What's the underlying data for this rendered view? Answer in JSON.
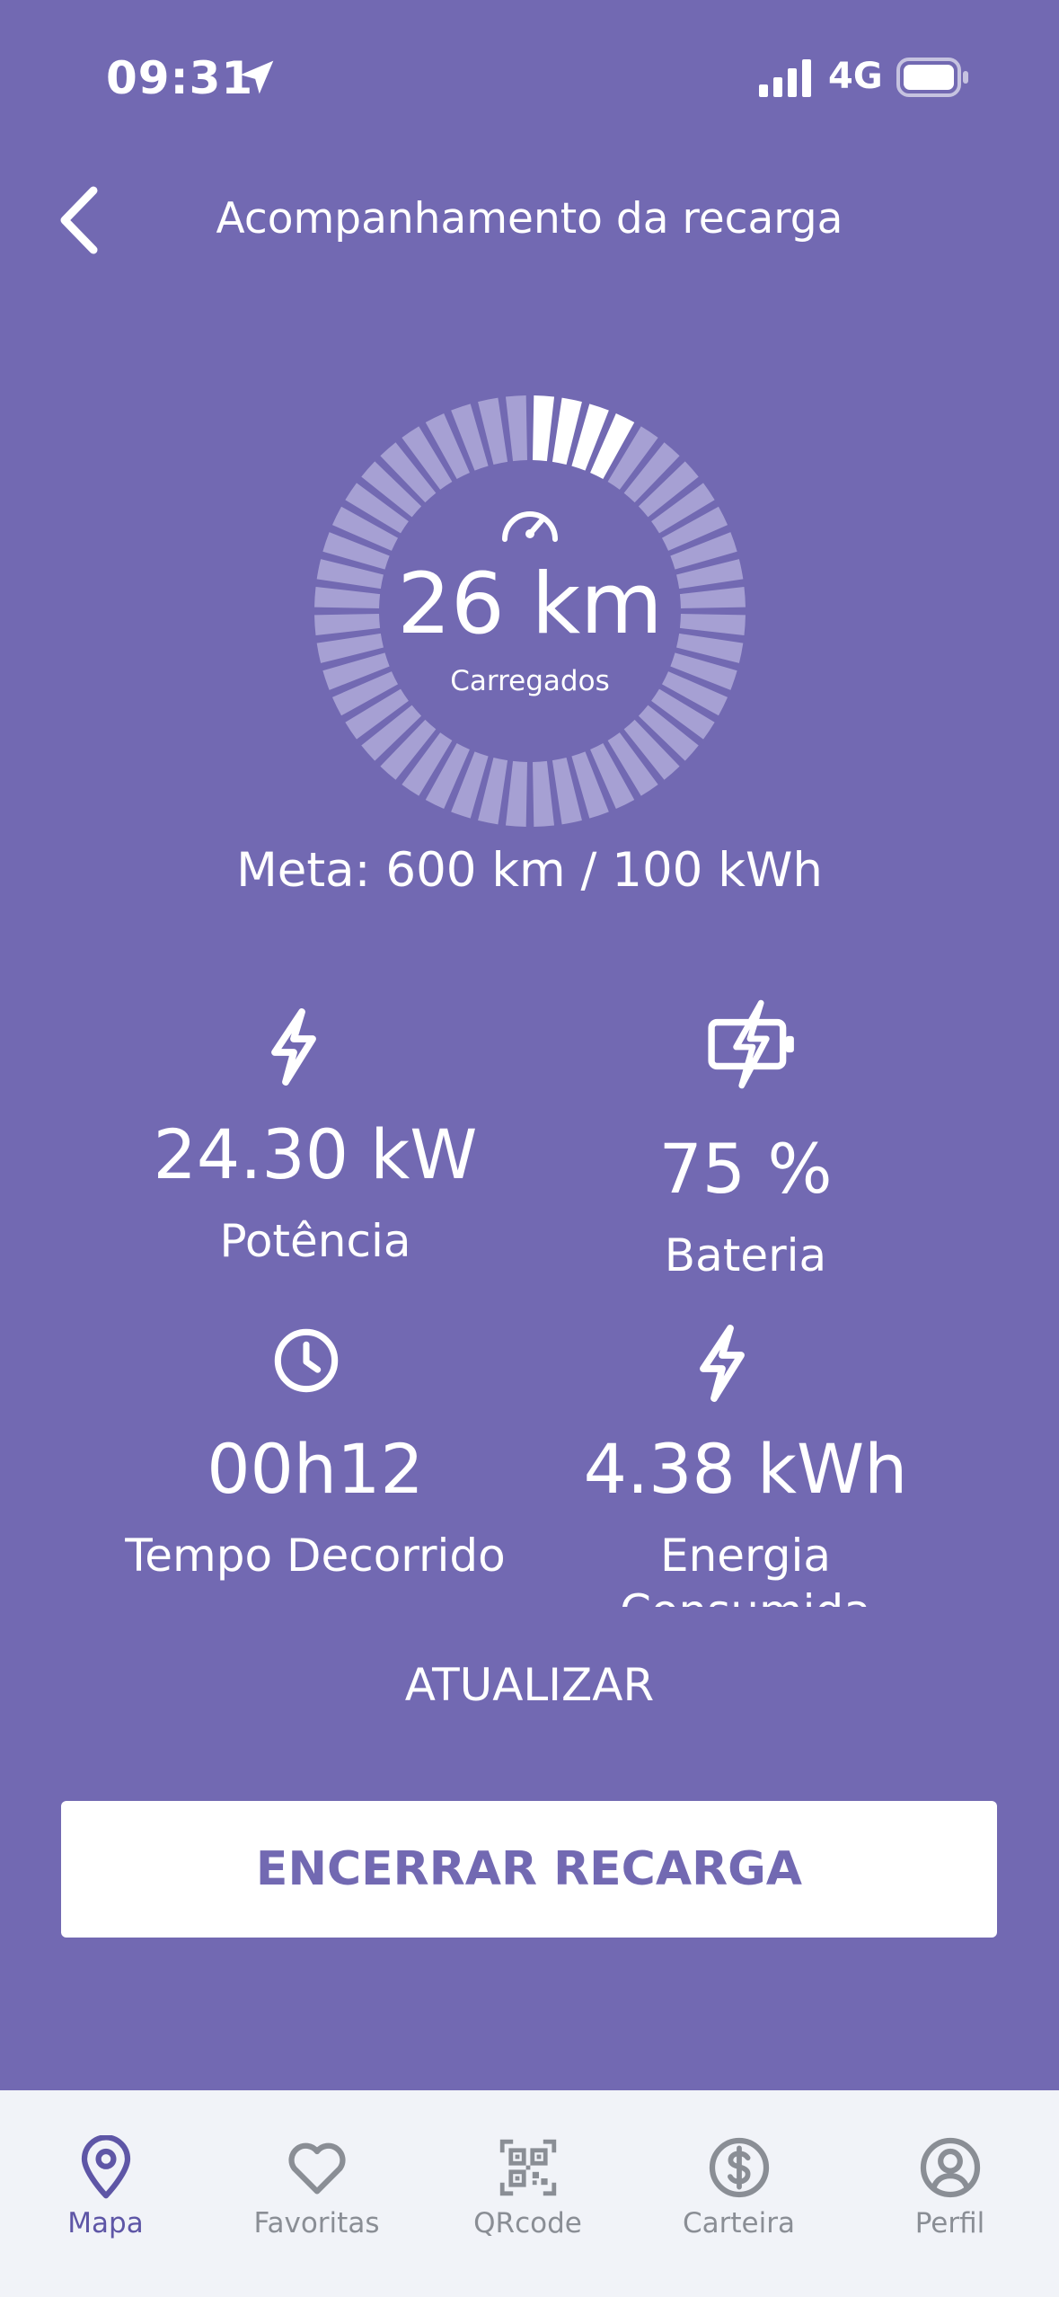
{
  "status": {
    "time": "09:31",
    "network": "4G"
  },
  "header": {
    "title": "Acompanhamento da recarga"
  },
  "charge": {
    "km": "26 km",
    "km_label": "Carregados",
    "goal": "Meta: 600 km / 100 kWh",
    "progress_fraction": 0.08
  },
  "stats": [
    {
      "value": "24.30 kW",
      "label": "Potência",
      "icon": "lightning-icon"
    },
    {
      "value": "75 %",
      "label": "Bateria",
      "icon": "battery-charging-icon"
    },
    {
      "value": "00h12",
      "label": "Tempo Decorrido",
      "icon": "clock-icon"
    },
    {
      "value": "4.38 kWh",
      "label": "Energia Consumida",
      "icon": "lightning-icon"
    }
  ],
  "actions": {
    "refresh": "ATUALIZAR",
    "end": "ENCERRAR RECARGA"
  },
  "tabs": [
    {
      "label": "Mapa",
      "icon": "map-pin-icon"
    },
    {
      "label": "Favoritas",
      "icon": "heart-icon"
    },
    {
      "label": "QRcode",
      "icon": "qrcode-icon"
    },
    {
      "label": "Carteira",
      "icon": "dollar-coin-icon"
    },
    {
      "label": "Perfil",
      "icon": "user-circle-icon"
    }
  ],
  "colors": {
    "background": "#7269B2",
    "accent": "#5E56A6",
    "tabbar": "#F1F3F8",
    "inactive": "#8A8E95"
  }
}
